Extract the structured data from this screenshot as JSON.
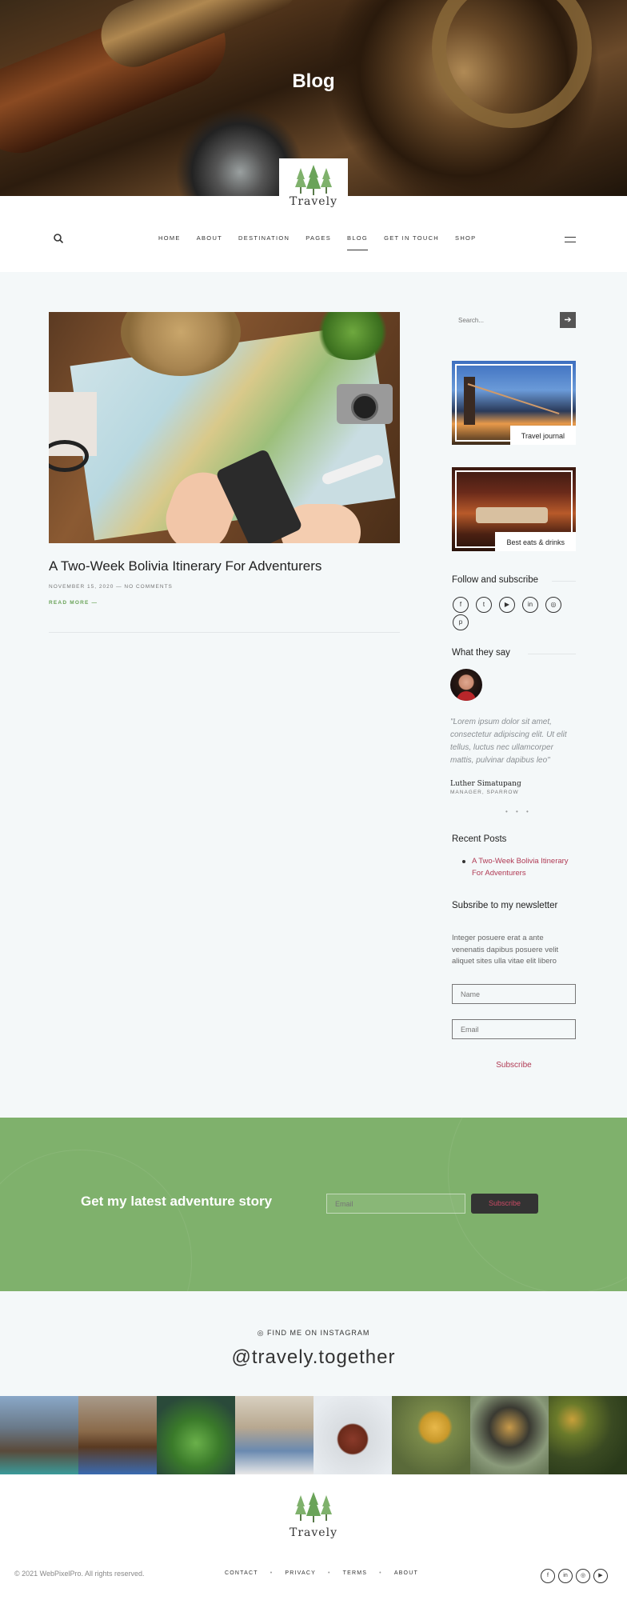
{
  "hero": {
    "title": "Blog"
  },
  "logo": {
    "text": "Travely"
  },
  "nav": {
    "items": [
      "HOME",
      "ABOUT",
      "DESTINATION",
      "PAGES",
      "BLOG",
      "GET IN TOUCH",
      "SHOP"
    ],
    "active": "BLOG"
  },
  "post": {
    "title": "A Two-Week Bolivia Itinerary For Adventurers",
    "meta": "NOVEMBER 15, 2020 — NO COMMENTS",
    "read_more": "READ MORE —"
  },
  "sidebar": {
    "search_placeholder": "Search...",
    "search_button_icon": "arrow-right-icon",
    "promos": [
      "Travel journal",
      "Best eats & drinks"
    ],
    "follow_heading": "Follow and subscribe",
    "social_icons": [
      "facebook-icon",
      "twitter-icon",
      "youtube-icon",
      "linkedin-icon",
      "instagram-icon",
      "pinterest-icon"
    ],
    "testimonial_heading": "What they say",
    "quote": "\"Lorem ipsum dolor sit amet, consectetur adipiscing elit. Ut elit tellus, luctus nec ullamcorper mattis, pulvinar dapibus leo\"",
    "quote_author": "Luther Simatupang",
    "quote_role": "MANAGER, SPARROW",
    "recent_heading": "Recent Posts",
    "recent_posts": [
      "A Two-Week Bolivia Itinerary For Adventurers"
    ],
    "newsletter_heading": "Subsribe to my newsletter",
    "newsletter_text": "Integer posuere erat a ante venenatis dapibus posuere velit aliquet sites ulla vitae elit libero",
    "name_placeholder": "Name",
    "email_placeholder": "Email",
    "subscribe_label": "Subscribe"
  },
  "band": {
    "title": "Get my latest adventure story",
    "email_placeholder": "Email",
    "button_label": "Subscribe"
  },
  "instagram": {
    "label": "FIND ME ON INSTAGRAM",
    "handle": "@travely.together"
  },
  "footer": {
    "copyright": "© 2021 WebPixelPro. All rights reserved.",
    "links": [
      "CONTACT",
      "PRIVACY",
      "TERMS",
      "ABOUT"
    ],
    "social_icons": [
      "facebook-icon",
      "linkedin-icon",
      "instagram-icon",
      "youtube-icon"
    ]
  },
  "colors": {
    "accent_green": "#7fb16c",
    "link_red": "#b03a54",
    "page_bg": "#f4f8f9"
  }
}
